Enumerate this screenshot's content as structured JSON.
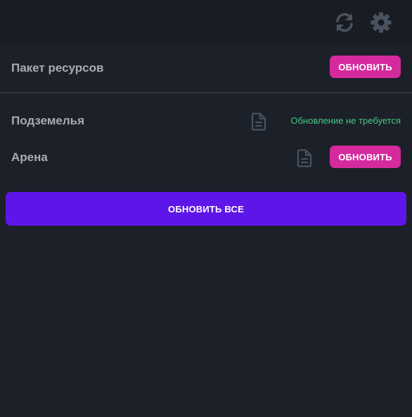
{
  "toolbar": {
    "refresh_icon": "refresh-icon",
    "settings_icon": "gear-icon"
  },
  "resource_pack": {
    "label": "Пакет ресурсов",
    "button_label": "ОБНОВИТЬ"
  },
  "items": [
    {
      "label": "Подземелья",
      "icon": "file-icon",
      "status": "Обновление не требуется"
    },
    {
      "label": "Арена",
      "icon": "file-icon",
      "button_label": "ОБНОВИТЬ"
    }
  ],
  "update_all_label": "ОБНОВИТЬ ВСЕ",
  "colors": {
    "background": "#1c2028",
    "topbar": "#191c22",
    "accent_pink": "#d52a9e",
    "accent_purple": "#5e16e8",
    "status_green": "#44c985",
    "icon_gray": "#4a5260"
  }
}
